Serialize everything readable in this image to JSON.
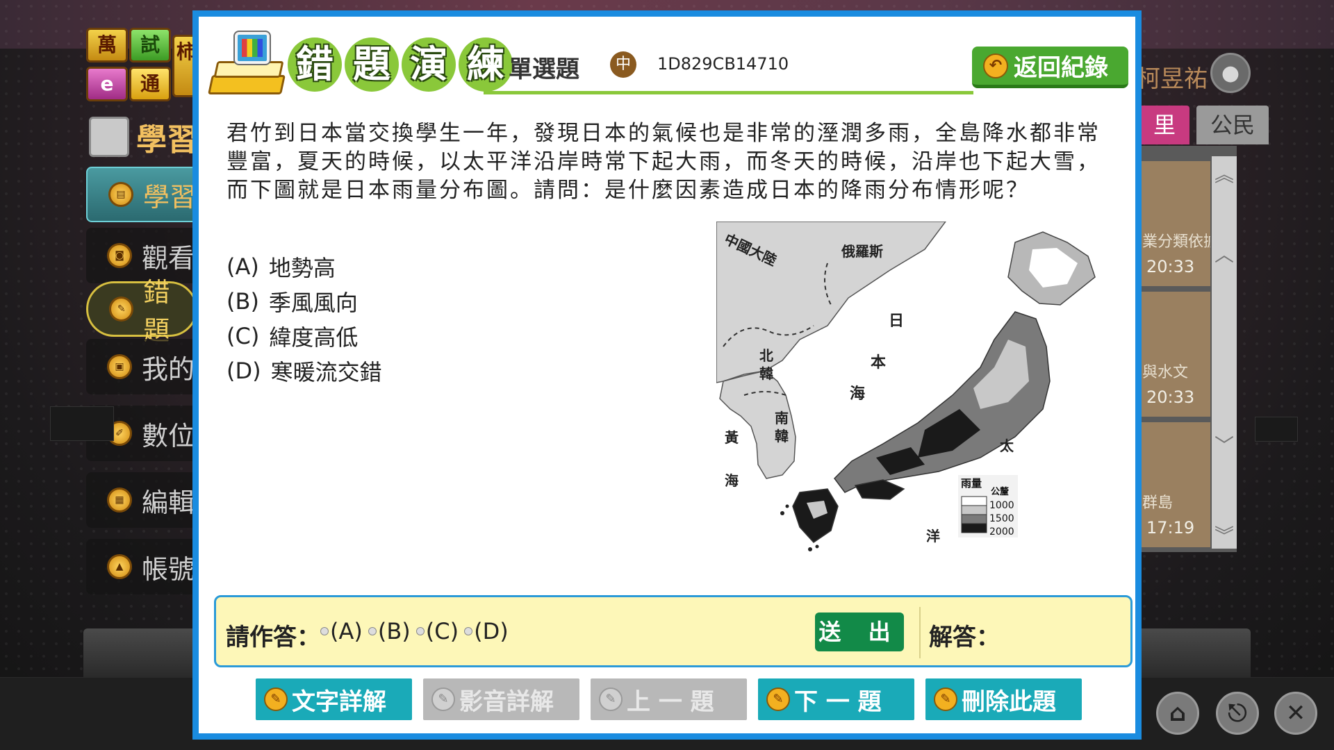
{
  "background": {
    "logo_tiles": [
      "萬",
      "試",
      "e",
      "通",
      "柿"
    ],
    "section_title": "學習",
    "menu": [
      {
        "label": "學習",
        "icon": "doc-icon",
        "state": "active"
      },
      {
        "label": "觀看",
        "icon": "camera-icon",
        "state": ""
      },
      {
        "label": "錯題",
        "icon": "pencil-note-icon",
        "state": "selected"
      },
      {
        "label": "我的",
        "icon": "folder-icon",
        "state": ""
      },
      {
        "label": "數位",
        "icon": "pen-icon",
        "state": ""
      },
      {
        "label": "編輯",
        "icon": "calendar-icon",
        "state": ""
      },
      {
        "label": "帳號",
        "icon": "graduation-cap-icon",
        "state": ""
      }
    ],
    "user_name": "柯昱祐",
    "subject_tabs": [
      "里",
      "公民"
    ],
    "records": [
      {
        "title": "業分類依據",
        "time": "20:33"
      },
      {
        "title": "與水文",
        "time": "20:33"
      },
      {
        "title": "群島",
        "time": "17:19"
      }
    ]
  },
  "modal": {
    "title_chars": [
      "錯",
      "題",
      "演",
      "練"
    ],
    "question_type": "單選題",
    "difficulty": "中",
    "question_id": "1D829CB14710",
    "back_label": "返回紀錄",
    "question_text": "君竹到日本當交換學生一年，發現日本的氣候也是非常的溼潤多雨，全島降水都非常豐富，夏天的時候，以太平洋沿岸時常下起大雨，而冬天的時候，沿岸也下起大雪，而下圖就是日本雨量分布圖。請問：是什麼因素造成日本的降雨分布情形呢？",
    "options": [
      {
        "key": "(A)",
        "text": "地勢高"
      },
      {
        "key": "(B)",
        "text": "季風風向"
      },
      {
        "key": "(C)",
        "text": "緯度高低"
      },
      {
        "key": "(D)",
        "text": "寒暖流交錯"
      }
    ],
    "map": {
      "labels": [
        "中國大陸",
        "俄羅斯",
        "日",
        "本",
        "海",
        "北",
        "韓",
        "南",
        "韓",
        "黃",
        "海",
        "太",
        "洋"
      ],
      "legend_title": "雨量",
      "legend_unit": "公釐",
      "legend_values": [
        "1000",
        "1500",
        "2000"
      ],
      "legend_colors": [
        "#ffffff",
        "#c8c8c8",
        "#7a7a7a",
        "#1a1a1a"
      ]
    },
    "answer_prompt": "請作答：",
    "choices": [
      "(A)",
      "(B)",
      "(C)",
      "(D)"
    ],
    "submit_label": "送 出",
    "answer_label": "解答：",
    "bottom_buttons": [
      {
        "label": "文字詳解",
        "enabled": true
      },
      {
        "label": "影音詳解",
        "enabled": false
      },
      {
        "label": "上 一 題",
        "enabled": false
      },
      {
        "label": "下 一 題",
        "enabled": true
      },
      {
        "label": "刪除此題",
        "enabled": true
      }
    ]
  },
  "colors": {
    "modal_border": "#1a8ce0",
    "title_green": "#8ac83a",
    "back_green": "#4aa830",
    "submit_green": "#128a48",
    "teal_button": "#1aaab8",
    "answer_bg": "#fdf7b8"
  }
}
